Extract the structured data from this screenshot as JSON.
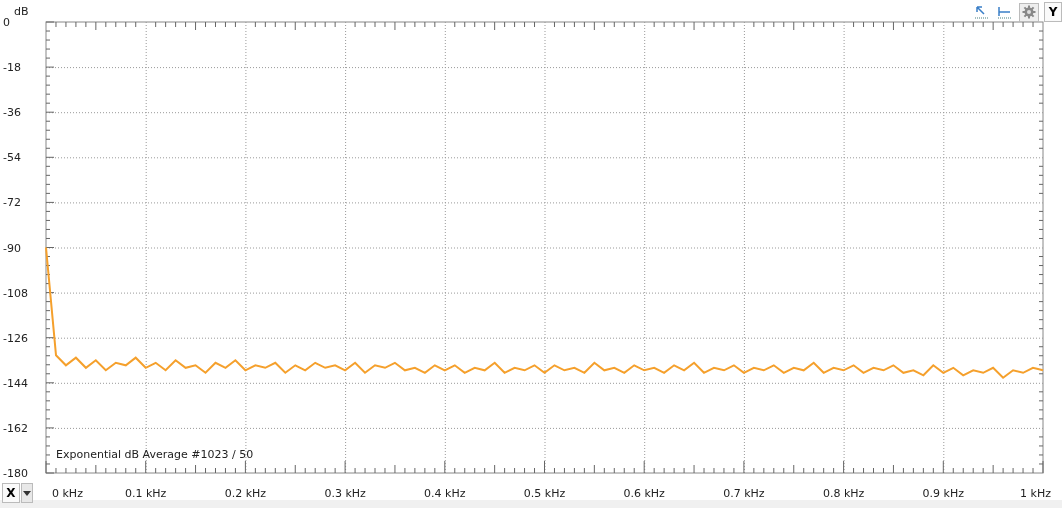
{
  "toolbar": {
    "y_button": "Y"
  },
  "chart": {
    "chart_data": {
      "type": "line",
      "grid": true,
      "ylabel": "dB",
      "xlim": [
        0,
        1
      ],
      "ylim": [
        -180,
        0
      ],
      "yticks": [
        0,
        -18,
        -36,
        -54,
        -72,
        -90,
        -108,
        -126,
        -144,
        -162,
        -180
      ],
      "xticks": [
        {
          "value": 0,
          "label": "0 kHz"
        },
        {
          "value": 0.1,
          "label": "0.1 kHz"
        },
        {
          "value": 0.2,
          "label": "0.2 kHz"
        },
        {
          "value": 0.3,
          "label": "0.3 kHz"
        },
        {
          "value": 0.4,
          "label": "0.4 kHz"
        },
        {
          "value": 0.5,
          "label": "0.5 kHz"
        },
        {
          "value": 0.6,
          "label": "0.6 kHz"
        },
        {
          "value": 0.7,
          "label": "0.7 kHz"
        },
        {
          "value": 0.8,
          "label": "0.8 kHz"
        },
        {
          "value": 0.9,
          "label": "0.9 kHz"
        },
        {
          "value": 1,
          "label": "1 kHz"
        }
      ],
      "x": [
        0,
        0.01,
        0.02,
        0.03,
        0.04,
        0.05,
        0.06,
        0.07,
        0.08,
        0.09,
        0.1,
        0.11,
        0.12,
        0.13,
        0.14,
        0.15,
        0.16,
        0.17,
        0.18,
        0.19,
        0.2,
        0.21,
        0.22,
        0.23,
        0.24,
        0.25,
        0.26,
        0.27,
        0.28,
        0.29,
        0.3,
        0.31,
        0.32,
        0.33,
        0.34,
        0.35,
        0.36,
        0.37,
        0.38,
        0.39,
        0.4,
        0.41,
        0.42,
        0.43,
        0.44,
        0.45,
        0.46,
        0.47,
        0.48,
        0.49,
        0.5,
        0.51,
        0.52,
        0.53,
        0.54,
        0.55,
        0.56,
        0.57,
        0.58,
        0.59,
        0.6,
        0.61,
        0.62,
        0.63,
        0.64,
        0.65,
        0.66,
        0.67,
        0.68,
        0.69,
        0.7,
        0.71,
        0.72,
        0.73,
        0.74,
        0.75,
        0.76,
        0.77,
        0.78,
        0.79,
        0.8,
        0.81,
        0.82,
        0.83,
        0.84,
        0.85,
        0.86,
        0.87,
        0.88,
        0.89,
        0.9,
        0.91,
        0.92,
        0.93,
        0.94,
        0.95,
        0.96,
        0.97,
        0.98,
        0.99,
        1
      ],
      "series": [
        {
          "name": "Exponential dB Average #1023 / 50",
          "color": "#f5a02c",
          "values": [
            -90,
            -133,
            -137,
            -134,
            -138,
            -135,
            -139,
            -136,
            -137,
            -134,
            -138,
            -136,
            -139,
            -135,
            -138,
            -137,
            -140,
            -136,
            -138,
            -135,
            -139,
            -137,
            -138,
            -136,
            -140,
            -137,
            -139,
            -136,
            -138,
            -137,
            -139,
            -136,
            -140,
            -137,
            -138,
            -136,
            -139,
            -138,
            -140,
            -137,
            -139,
            -137,
            -140,
            -138,
            -139,
            -136,
            -140,
            -138,
            -139,
            -137,
            -140,
            -137,
            -139,
            -138,
            -140,
            -136,
            -139,
            -138,
            -140,
            -137,
            -139,
            -138,
            -140,
            -137,
            -139,
            -136,
            -140,
            -138,
            -139,
            -137,
            -140,
            -138,
            -139,
            -137,
            -140,
            -138,
            -139,
            -136,
            -140,
            -138,
            -139,
            -137,
            -140,
            -138,
            -139,
            -137,
            -140,
            -139,
            -141,
            -137,
            -140,
            -138,
            -141,
            -139,
            -140,
            -138,
            -142,
            -139,
            -140,
            -138,
            -139
          ]
        }
      ]
    }
  },
  "x_control": {
    "label": "X"
  }
}
